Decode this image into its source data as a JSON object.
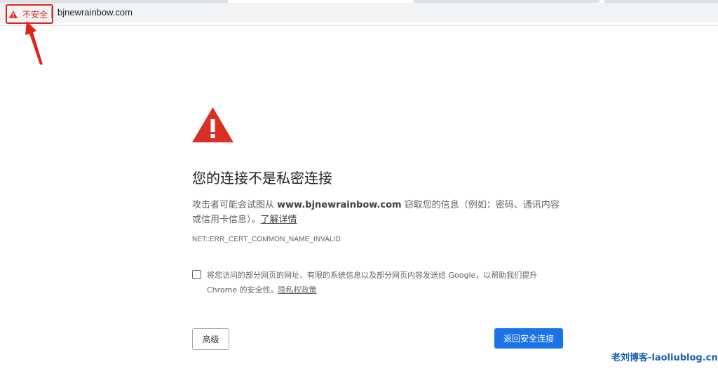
{
  "address_bar": {
    "security_label": "不安全",
    "url": "bjnewrainbow.com"
  },
  "interstitial": {
    "heading": "您的连接不是私密连接",
    "desc_prefix": "攻击者可能会试图从 ",
    "desc_domain": "www.bjnewrainbow.com",
    "desc_suffix": " 窃取您的信息（例如：密码、通讯内容或信用卡信息）。",
    "learn_more": "了解详情",
    "error_code": "NET::ERR_CERT_COMMON_NAME_INVALID",
    "optin_text": "将您访问的部分网页的网址、有限的系统信息以及部分网页内容发送给 Google，以帮助我们提升 Chrome 的安全性。",
    "privacy_link": "隐私权政策",
    "advanced_button": "高级",
    "back_button": "返回安全连接"
  },
  "watermark": "老刘博客-laoliublog.cn",
  "colors": {
    "warning_red": "#d93025",
    "annotation_red": "#e0231c",
    "primary_blue": "#1a73e8",
    "watermark_blue": "#1a5fb4"
  },
  "icons": {
    "security": "warning-triangle-icon",
    "main": "warning-triangle-icon",
    "annotation": "red-arrow-annotation"
  }
}
